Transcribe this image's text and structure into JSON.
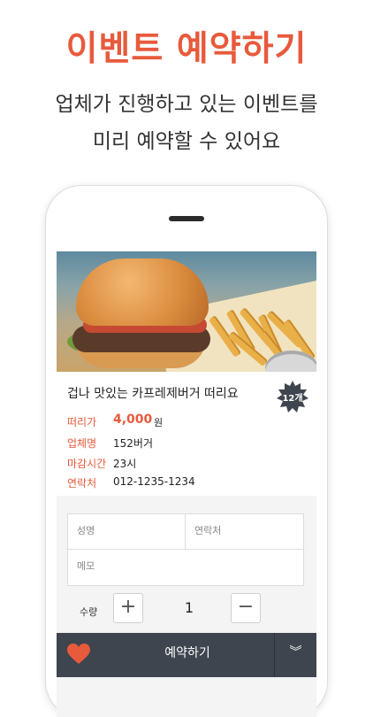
{
  "header": {
    "title": "이벤트 예약하기",
    "subtitle_line1": "업체가 진행하고 있는 이벤트를",
    "subtitle_line2": "미리 예약할 수 있어요"
  },
  "event": {
    "title": "겁나 맛있는 카프레제버거 떠리요",
    "badge": "12개",
    "rows": [
      {
        "label": "떠리가",
        "value": "4,000",
        "unit": "원"
      },
      {
        "label": "업체명",
        "value": "152버거"
      },
      {
        "label": "마감시간",
        "value": "23시"
      },
      {
        "label": "연락처",
        "value": "012-1235-1234"
      }
    ]
  },
  "form": {
    "name_placeholder": "성명",
    "contact_placeholder": "연락처",
    "memo_placeholder": "메모",
    "quantity_label": "수량",
    "quantity_value": "1",
    "plus": "+",
    "minus": "−"
  },
  "bottom_bar": {
    "reserve_label": "예약하기",
    "heart_icon": "heart-icon",
    "expand_icon": "double-chevron-down-icon",
    "expand_glyph": "︾"
  },
  "colors": {
    "accent": "#e85a3c",
    "bar": "#3e454e",
    "badge": "#3e454e"
  }
}
